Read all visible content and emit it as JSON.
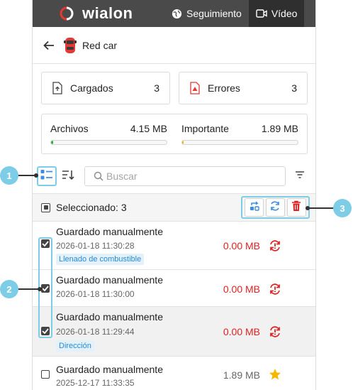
{
  "app": {
    "logo_text": "wialon",
    "nav": [
      {
        "label": "Seguimiento",
        "icon": "globe-icon",
        "active": false
      },
      {
        "label": "Vídeo",
        "icon": "video-icon",
        "active": true
      }
    ]
  },
  "header": {
    "unit_name": "Red car"
  },
  "stats": {
    "loaded_label": "Cargados",
    "loaded_value": "3",
    "errors_label": "Errores",
    "errors_value": "3",
    "files_label": "Archivos",
    "files_value": "4.15 MB",
    "files_fill": 0.02,
    "important_label": "Importante",
    "important_value": "1.89 MB",
    "important_fill": 0.01
  },
  "toolbar": {
    "search_placeholder": "Buscar"
  },
  "selection": {
    "label": "Seleccionado: 3"
  },
  "files": [
    {
      "title": "Guardado manualmente",
      "time": "2026-01-18 11:30:28",
      "tag": "Llenado de combustible",
      "size": "0.00 MB",
      "status": "error",
      "checked": true
    },
    {
      "title": "Guardado manualmente",
      "time": "2026-01-18 11:30:00",
      "tag": "",
      "size": "0.00 MB",
      "status": "error",
      "checked": true
    },
    {
      "title": "Guardado manualmente",
      "time": "2026-01-18 11:29:44",
      "tag": "Dirección",
      "size": "0.00 MB",
      "status": "error",
      "checked": true
    },
    {
      "title": "Guardado manualmente",
      "time": "2025-12-17 11:33:35",
      "tag": "",
      "size": "1.89 MB",
      "status": "important",
      "checked": false
    }
  ],
  "callouts": [
    "1",
    "2",
    "3"
  ],
  "colors": {
    "accent": "#7ecde6",
    "error": "#e02020",
    "star": "#f5b800",
    "topbar": "#4a4a4a"
  }
}
